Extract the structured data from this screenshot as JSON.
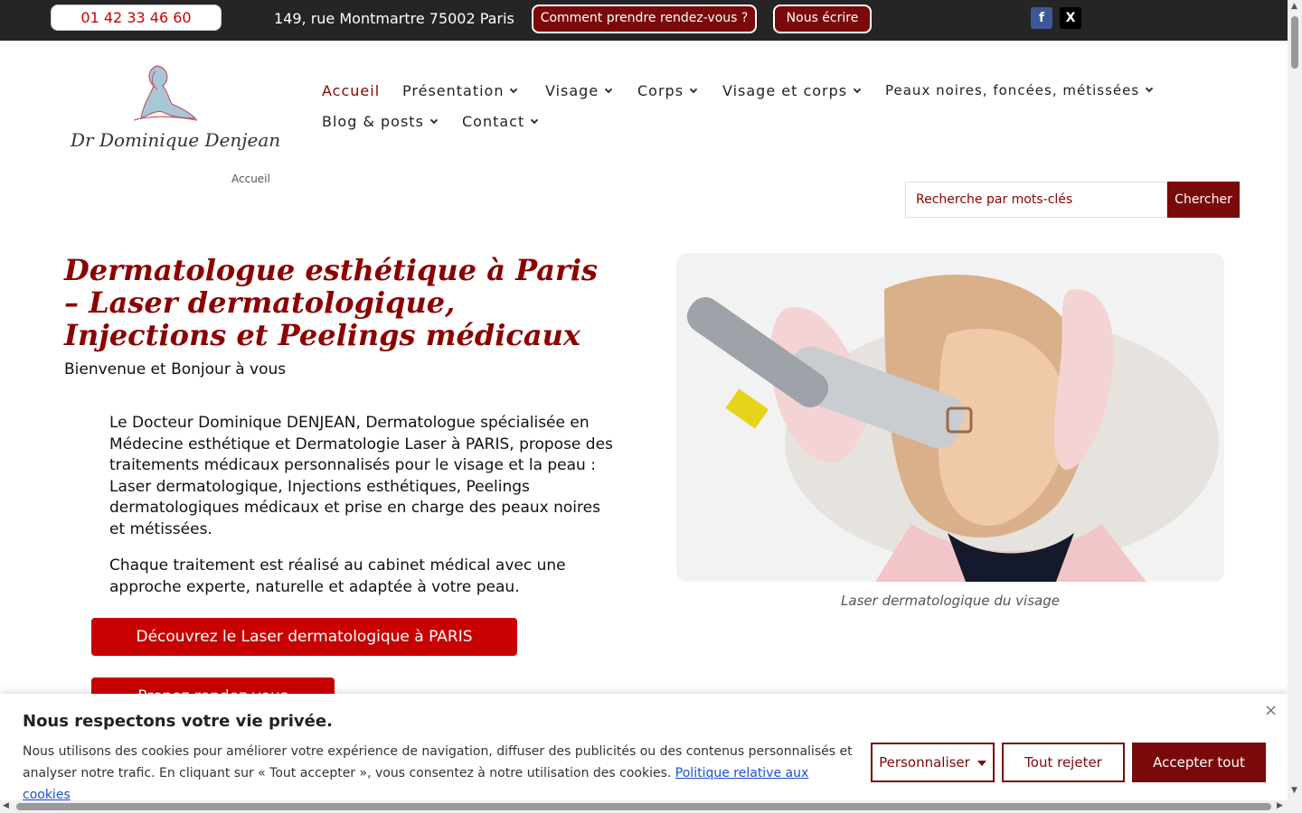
{
  "topbar": {
    "phone": "01 42 33 46 60",
    "address": "149, rue Montmartre 75002 Paris",
    "rdv_label": "Comment prendre rendez-vous ?",
    "ecrire_label": "Nous écrire",
    "facebook_glyph": "f",
    "x_glyph": "X"
  },
  "header": {
    "logo_name": "Dr Dominique Denjean",
    "breadcrumb": "Accueil",
    "nav": [
      {
        "label": "Accueil"
      },
      {
        "label": "Présentation"
      },
      {
        "label": "Visage"
      },
      {
        "label": "Corps"
      },
      {
        "label": "Visage et corps"
      },
      {
        "label": "Peaux noires, foncées, métissées"
      },
      {
        "label": "Blog & posts"
      },
      {
        "label": "Contact"
      }
    ],
    "search_placeholder": "Recherche par mots-clés",
    "search_button": "Chercher"
  },
  "main": {
    "title": "Dermatologue esthétique à Paris – Laser dermatologique, Injections et Peelings médicaux",
    "subtitle": "Bienvenue et Bonjour à vous",
    "para1": "Le Docteur Dominique DENJEAN, Dermatologue spécialisée en Médecine esthétique et Dermatologie Laser à PARIS, propose des traitements médicaux personnalisés pour le visage et la peau : Laser dermatologique, Injections esthétiques, Peelings dermatologiques médicaux et prise en charge des peaux noires et métissées.",
    "para2": "Chaque traitement est réalisé au cabinet médical avec une approche experte, naturelle et adaptée à votre peau.",
    "cta1": "Découvrez le Laser dermatologique à PARIS",
    "cta2": "Prenez rendez-vous",
    "caption": "Laser dermatologique du visage"
  },
  "cookie": {
    "title": "Nous respectons votre vie privée.",
    "text": "Nous utilisons des cookies pour améliorer votre expérience de navigation, diffuser des publicités ou des contenus personnalisés et analyser notre trafic. En cliquant sur « Tout accepter », vous consentez à notre utilisation des cookies.",
    "link": "Politique relative aux cookies",
    "customize": "Personnaliser",
    "reject": "Tout rejeter",
    "accept": "Accepter tout",
    "close": "×"
  }
}
